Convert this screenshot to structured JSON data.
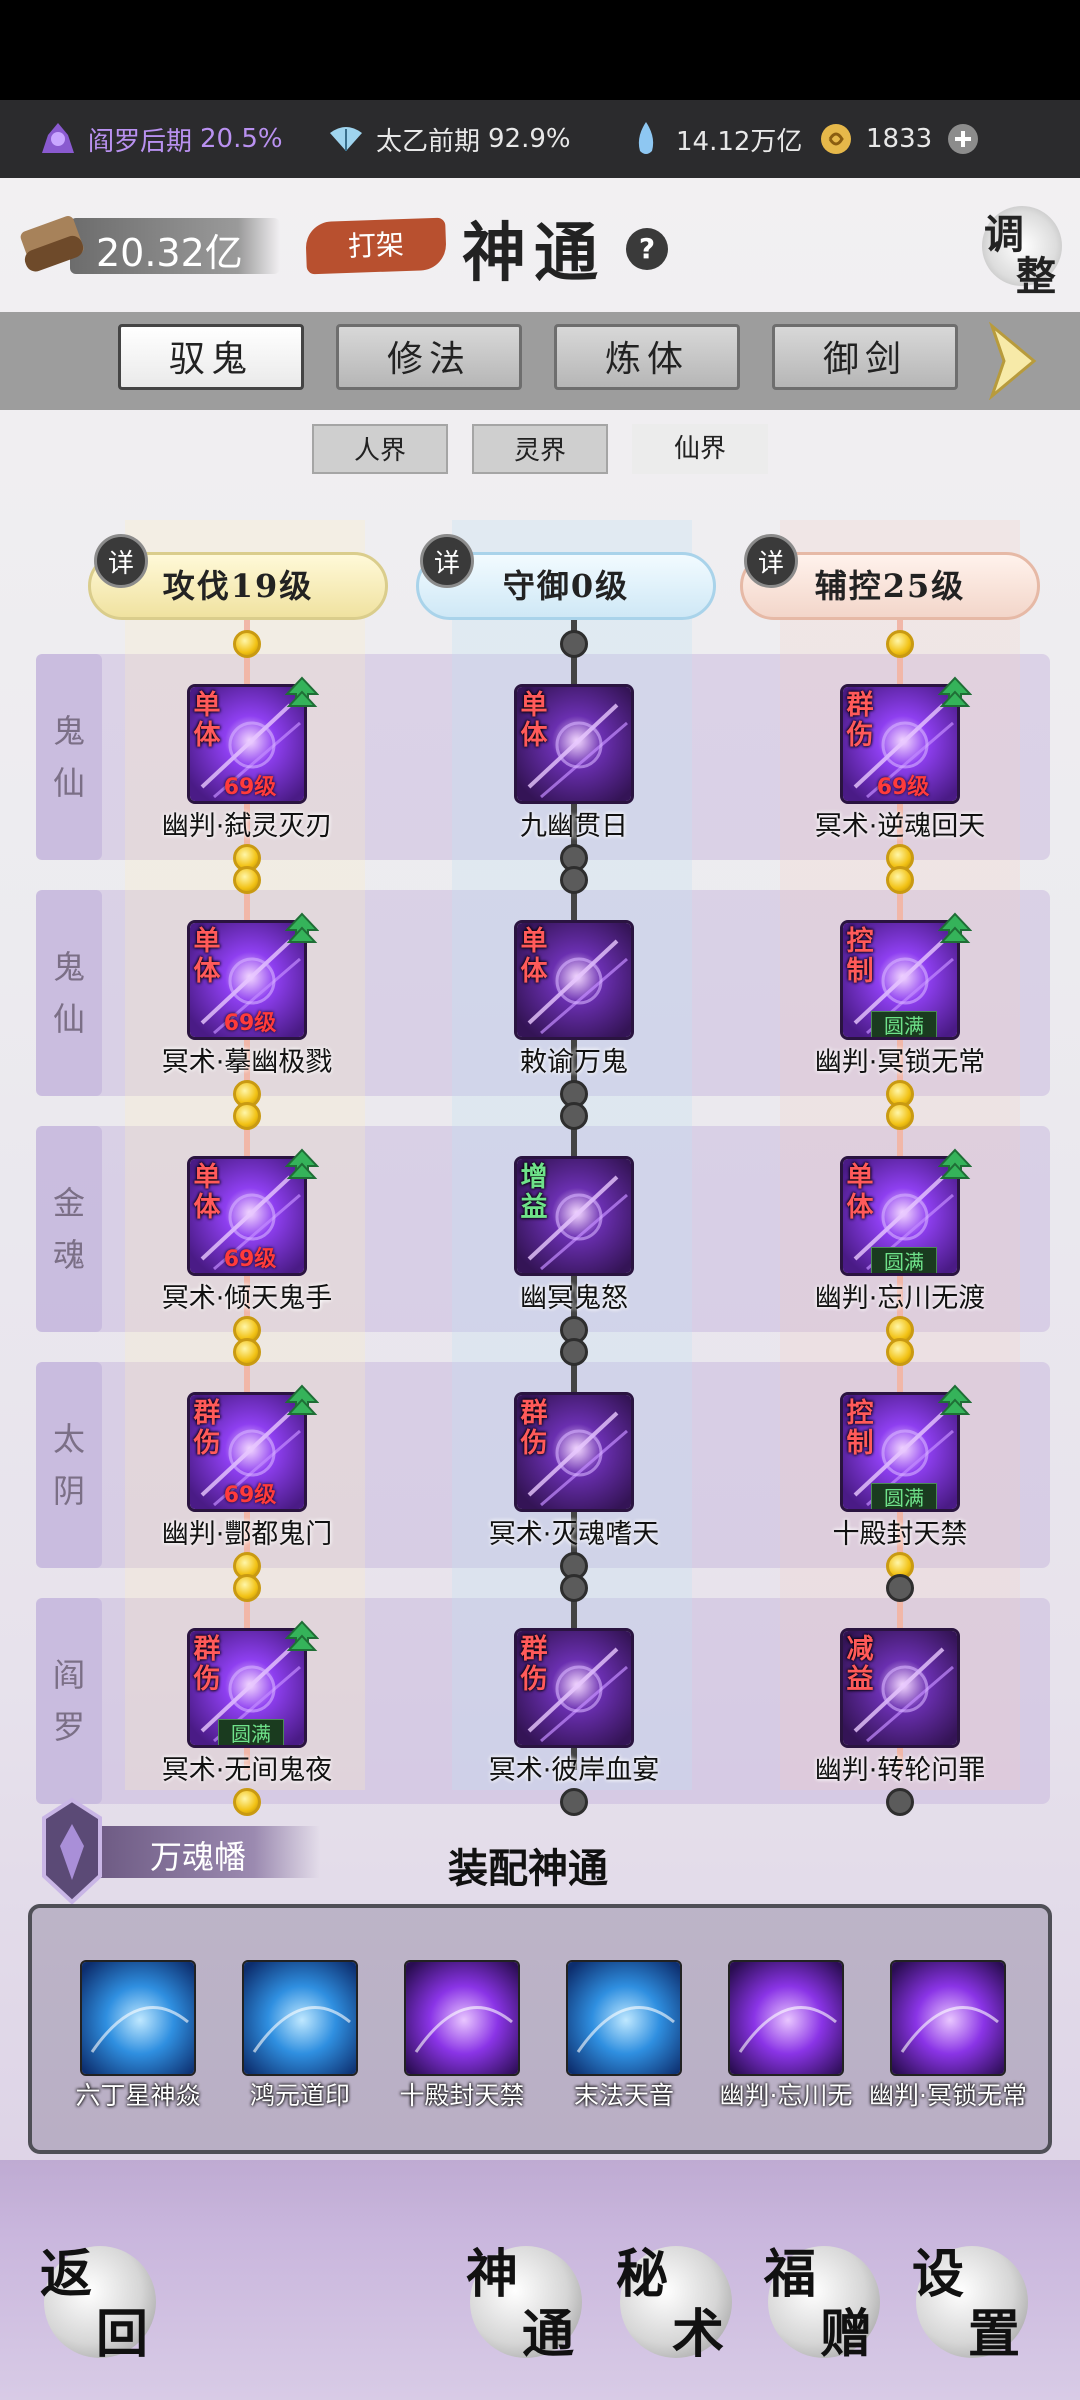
{
  "resources": [
    {
      "icon": "yama-realm-icon",
      "label": "阎罗后期",
      "value": "20.5%",
      "color": "#b991f0"
    },
    {
      "icon": "fan-icon",
      "label": "太乙前期",
      "value": "92.9%",
      "color": "#e8e8e8"
    },
    {
      "icon": "spirit-crystal-icon",
      "label": "",
      "value": "14.12万亿",
      "color": "#e8e8e8"
    },
    {
      "icon": "gold-coin-icon",
      "label": "",
      "value": "1833",
      "color": "#e8e8e8"
    }
  ],
  "header": {
    "power": "20.32亿",
    "fight_tag": "打架",
    "title": "神通",
    "help": "?",
    "adjust_1": "调",
    "adjust_2": "整"
  },
  "categories": [
    "驭鬼",
    "修法",
    "炼体",
    "御剑"
  ],
  "realms": [
    "人界",
    "灵界",
    "仙界"
  ],
  "branches": {
    "detail": "详",
    "attack": "攻伐19级",
    "defense": "守御0级",
    "control": "辅控25级"
  },
  "rows": [
    {
      "label": [
        "鬼",
        "仙"
      ],
      "skills": [
        {
          "type": [
            "单",
            "体"
          ],
          "type_color": "red",
          "name": "幽判·弑灵灭刃",
          "level": "69级",
          "full": "",
          "upgrade": true,
          "lit": true
        },
        {
          "type": [
            "单",
            "体"
          ],
          "type_color": "red",
          "name": "九幽贯日",
          "level": "",
          "full": "",
          "upgrade": false,
          "lit": false
        },
        {
          "type": [
            "群",
            "伤"
          ],
          "type_color": "red",
          "name": "冥术·逆魂回天",
          "level": "69级",
          "full": "",
          "upgrade": true,
          "lit": true
        }
      ]
    },
    {
      "label": [
        "鬼",
        "仙"
      ],
      "skills": [
        {
          "type": [
            "单",
            "体"
          ],
          "type_color": "red",
          "name": "冥术·摹幽极戮",
          "level": "69级",
          "full": "",
          "upgrade": true,
          "lit": true
        },
        {
          "type": [
            "单",
            "体"
          ],
          "type_color": "red",
          "name": "敕谕万鬼",
          "level": "",
          "full": "",
          "upgrade": false,
          "lit": false
        },
        {
          "type": [
            "控",
            "制"
          ],
          "type_color": "red",
          "name": "幽判·冥锁无常",
          "level": "",
          "full": "圆满",
          "upgrade": true,
          "lit": true
        }
      ]
    },
    {
      "label": [
        "金",
        "魂"
      ],
      "skills": [
        {
          "type": [
            "单",
            "体"
          ],
          "type_color": "red",
          "name": "冥术·倾天鬼手",
          "level": "69级",
          "full": "",
          "upgrade": true,
          "lit": true
        },
        {
          "type": [
            "增",
            "益"
          ],
          "type_color": "green",
          "name": "幽冥鬼怒",
          "level": "",
          "full": "",
          "upgrade": false,
          "lit": false
        },
        {
          "type": [
            "单",
            "体"
          ],
          "type_color": "red",
          "name": "幽判·忘川无渡",
          "level": "",
          "full": "圆满",
          "upgrade": true,
          "lit": true
        }
      ]
    },
    {
      "label": [
        "太",
        "阴"
      ],
      "skills": [
        {
          "type": [
            "群",
            "伤"
          ],
          "type_color": "red",
          "name": "幽判·酆都鬼门",
          "level": "69级",
          "full": "",
          "upgrade": true,
          "lit": true
        },
        {
          "type": [
            "群",
            "伤"
          ],
          "type_color": "red",
          "name": "冥术·灭魂嗜天",
          "level": "",
          "full": "",
          "upgrade": false,
          "lit": false
        },
        {
          "type": [
            "控",
            "制"
          ],
          "type_color": "red",
          "name": "十殿封天禁",
          "level": "",
          "full": "圆满",
          "upgrade": true,
          "lit": true
        }
      ]
    },
    {
      "label": [
        "阎",
        "罗"
      ],
      "skills": [
        {
          "type": [
            "群",
            "伤"
          ],
          "type_color": "red",
          "name": "冥术·无间鬼夜",
          "level": "",
          "full": "圆满",
          "upgrade": true,
          "lit": true
        },
        {
          "type": [
            "群",
            "伤"
          ],
          "type_color": "red",
          "name": "冥术·彼岸血宴",
          "level": "",
          "full": "",
          "upgrade": false,
          "lit": false
        },
        {
          "type": [
            "减",
            "益"
          ],
          "type_color": "red",
          "name": "幽判·转轮问罪",
          "level": "",
          "full": "",
          "upgrade": false,
          "lit": false
        }
      ]
    }
  ],
  "soul": {
    "label": "万魂幡"
  },
  "equip": {
    "title": "装配神通",
    "slots": [
      {
        "name": "六丁星神焱",
        "theme": "blue"
      },
      {
        "name": "鸿元道印",
        "theme": "blue"
      },
      {
        "name": "十殿封天禁",
        "theme": "purple"
      },
      {
        "name": "末法天音",
        "theme": "blue"
      },
      {
        "name": "幽判·忘川无",
        "theme": "purple"
      },
      {
        "name": "幽判·冥锁无常",
        "theme": "purple"
      }
    ]
  },
  "nav": [
    {
      "c1": "返",
      "c2": "回"
    },
    {
      "c1": "神",
      "c2": "通"
    },
    {
      "c1": "秘",
      "c2": "术"
    },
    {
      "c1": "福",
      "c2": "赠"
    },
    {
      "c1": "设",
      "c2": "置"
    }
  ]
}
